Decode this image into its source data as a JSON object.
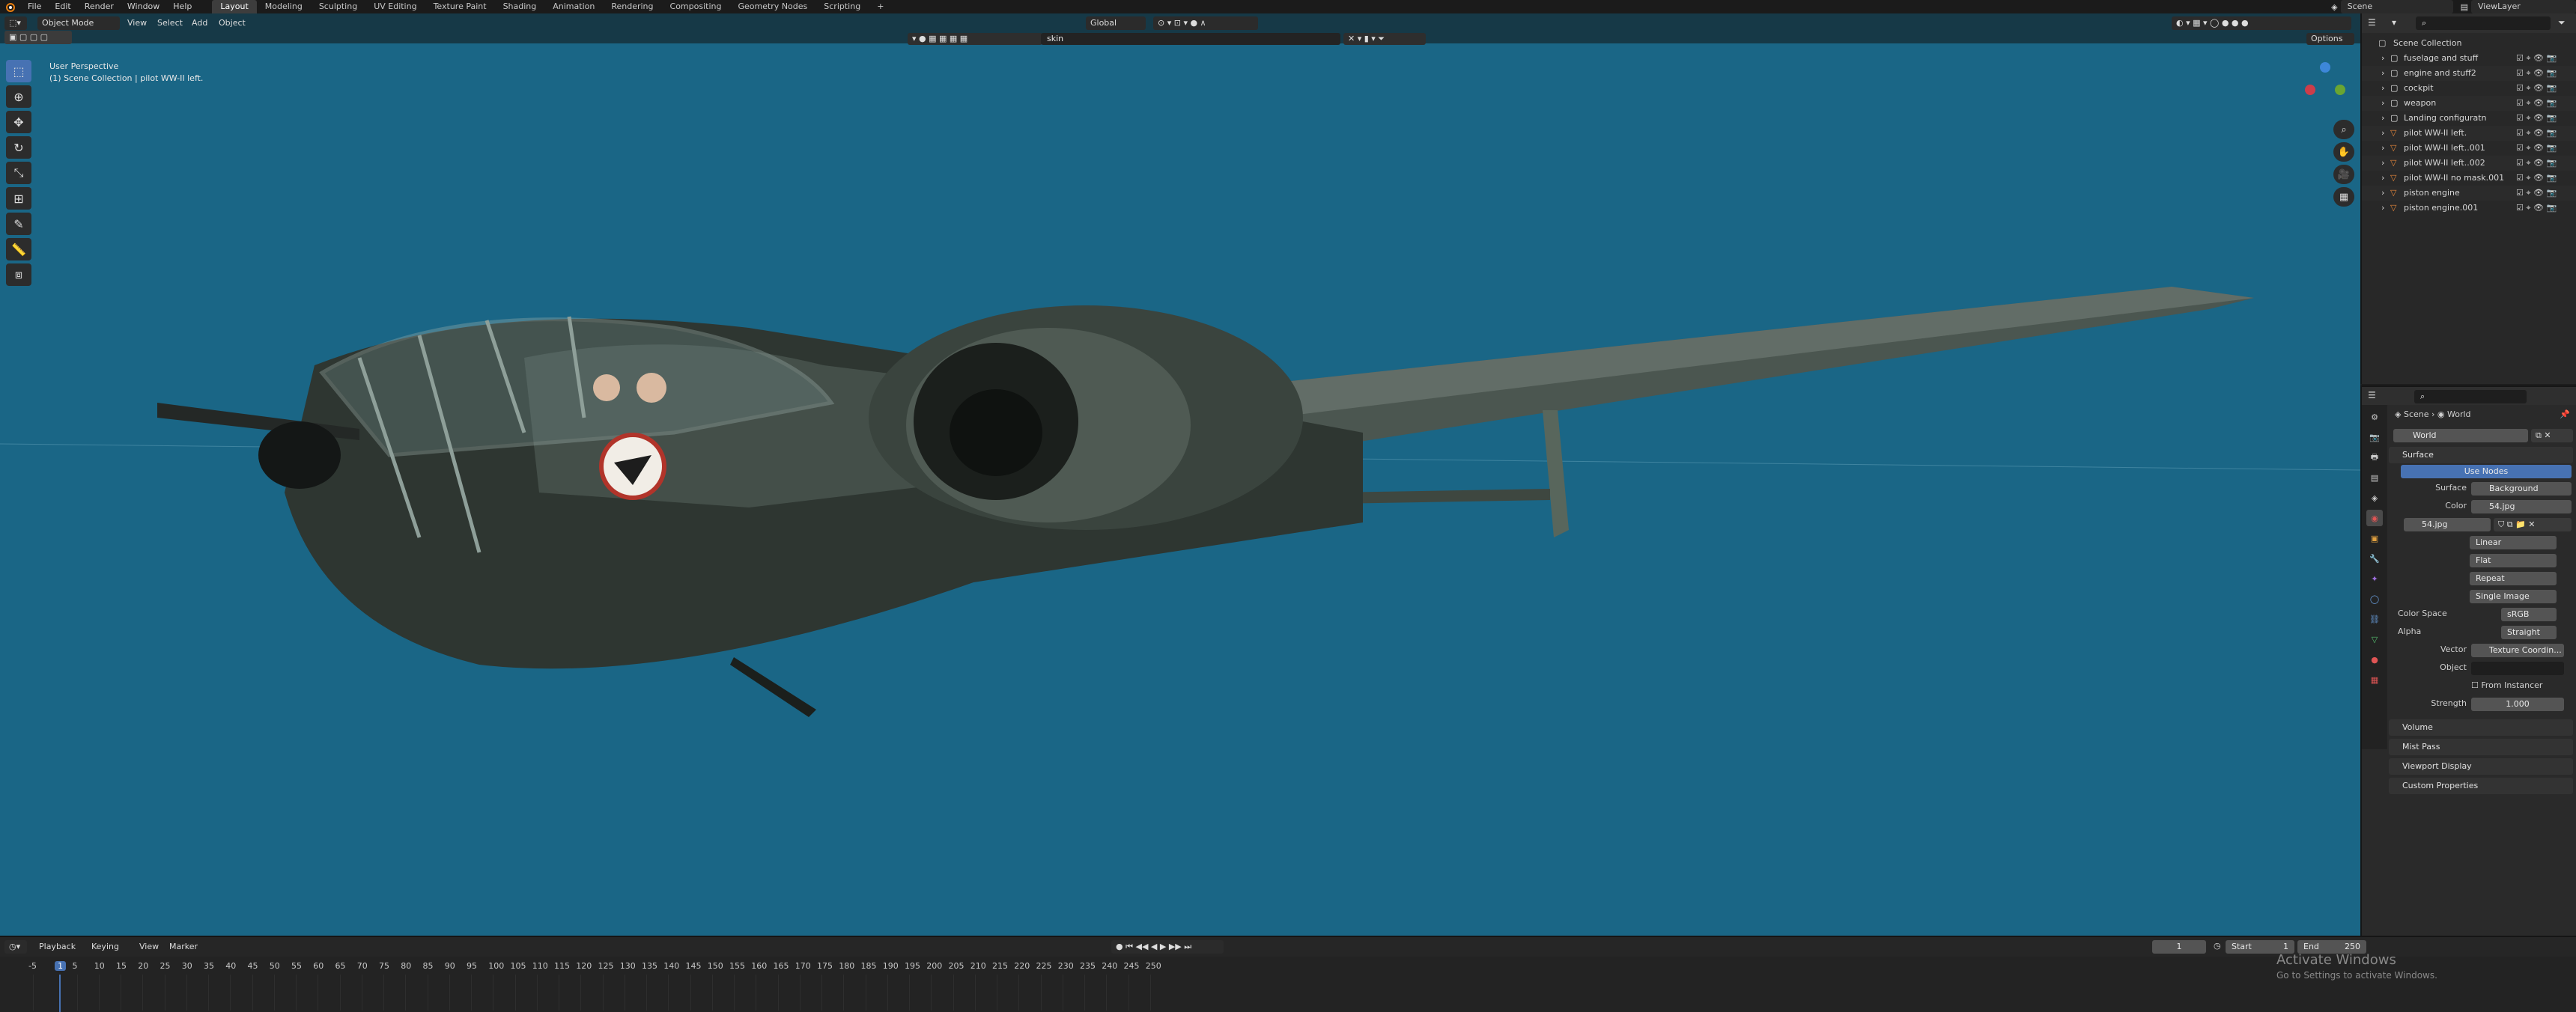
{
  "topbar": {
    "menus": [
      "File",
      "Edit",
      "Render",
      "Window",
      "Help"
    ],
    "workspaces": [
      "Layout",
      "Modeling",
      "Sculpting",
      "UV Editing",
      "Texture Paint",
      "Shading",
      "Animation",
      "Rendering",
      "Compositing",
      "Geometry Nodes",
      "Scripting"
    ],
    "active_workspace": "Layout",
    "add_tab": "+",
    "scene": "Scene",
    "view_layer": "ViewLayer"
  },
  "viewport": {
    "mode": "Object Mode",
    "menus": [
      "View",
      "Select",
      "Add",
      "Object"
    ],
    "orientation": "Global",
    "search_value": "skin",
    "options_label": "Options",
    "info_line1": "User Perspective",
    "info_line2": "(1) Scene Collection | pilot WW-II left.",
    "background_color": "#1a6686"
  },
  "outliner": {
    "search_placeholder": "",
    "root": "Scene Collection",
    "items": [
      {
        "label": "fuselage and stuff",
        "type": "collection"
      },
      {
        "label": "engine and stuff2",
        "type": "collection"
      },
      {
        "label": "cockpit",
        "type": "collection"
      },
      {
        "label": "weapon",
        "type": "collection"
      },
      {
        "label": "Landing configuratn",
        "type": "collection"
      },
      {
        "label": "pilot WW-II left.",
        "type": "object"
      },
      {
        "label": "pilot WW-II left..001",
        "type": "object"
      },
      {
        "label": "pilot WW-II left..002",
        "type": "object"
      },
      {
        "label": "pilot WW-II no mask.001",
        "type": "object"
      },
      {
        "label": "piston engine",
        "type": "object"
      },
      {
        "label": "piston engine.001",
        "type": "object"
      }
    ]
  },
  "properties": {
    "breadcrumb_scene": "Scene",
    "breadcrumb_world": "World",
    "world_name": "World",
    "surface_header": "Surface",
    "use_nodes": "Use Nodes",
    "surface_label": "Surface",
    "surface_value": "Background",
    "color_label": "Color",
    "color_value": "54.jpg",
    "image_name": "54.jpg",
    "interpolation": "Linear",
    "projection": "Flat",
    "extension": "Repeat",
    "source": "Single Image",
    "color_space_label": "Color Space",
    "color_space_value": "sRGB",
    "alpha_label": "Alpha",
    "alpha_value": "Straight",
    "vector_label": "Vector",
    "vector_value": "Texture Coordin...",
    "object_label": "Object",
    "from_instancer": "From Instancer",
    "strength_label": "Strength",
    "strength_value": "1.000",
    "sections": [
      "Volume",
      "Mist Pass",
      "Viewport Display",
      "Custom Properties"
    ]
  },
  "timeline": {
    "menus": [
      "Playback",
      "Keying",
      "View",
      "Marker"
    ],
    "current_frame": "1",
    "start_label": "Start",
    "start_value": "1",
    "end_label": "End",
    "end_value": "250",
    "ticks": [
      "-5",
      "1",
      "5",
      "10",
      "15",
      "20",
      "25",
      "30",
      "35",
      "40",
      "45",
      "50",
      "55",
      "60",
      "65",
      "70",
      "75",
      "80",
      "85",
      "90",
      "95",
      "100",
      "105",
      "110",
      "115",
      "120",
      "125",
      "130",
      "135",
      "140",
      "145",
      "150",
      "155",
      "160",
      "165",
      "170",
      "175",
      "180",
      "185",
      "190",
      "195",
      "200",
      "205",
      "210",
      "215",
      "220",
      "225",
      "230",
      "235",
      "240",
      "245",
      "250"
    ],
    "activate_title": "Activate Windows",
    "activate_sub": "Go to Settings to activate Windows."
  }
}
